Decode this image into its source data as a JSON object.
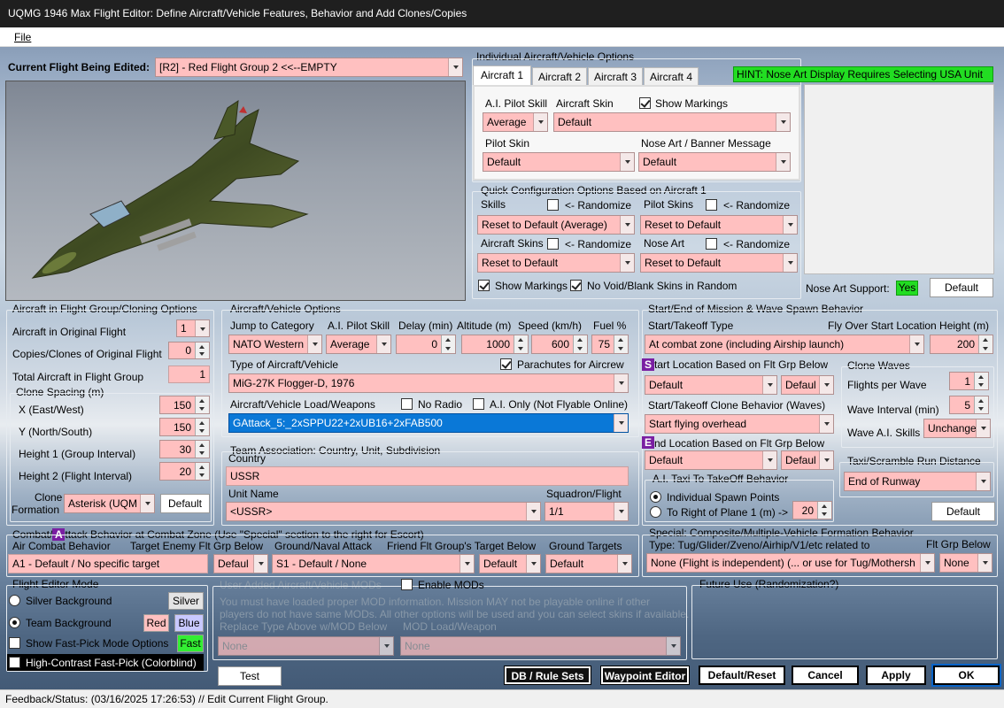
{
  "window": {
    "title": "UQMG 1946 Max Flight Editor:  Define Aircraft/Vehicle Features, Behavior and Add Clones/Copies"
  },
  "menu": {
    "file": "File"
  },
  "flight": {
    "label": "Current Flight Being Edited:",
    "value": "[R2] -  Red Flight Group  2     <<--EMPTY"
  },
  "individual": {
    "title": "Individual Aircraft/Vehicle Options",
    "tabs": [
      "Aircraft 1",
      "Aircraft 2",
      "Aircraft 3",
      "Aircraft 4"
    ],
    "hint": "HINT:  Nose Art Display Requires Selecting USA Unit",
    "ai_pilot_skill_label": "A.I. Pilot Skill",
    "ai_pilot_skill": "Average",
    "aircraft_skin_label": "Aircraft Skin",
    "aircraft_skin": "Default",
    "show_markings": "Show Markings",
    "pilot_skin_label": "Pilot Skin",
    "pilot_skin": "Default",
    "nose_art_label": "Nose Art / Banner Message",
    "nose_art": "Default"
  },
  "quick": {
    "title": "Quick Configuration Options Based on Aircraft 1",
    "skills_label": "Skills",
    "randomize": "<- Randomize",
    "skills": "Reset to Default (Average)",
    "pilot_skins_label": "Pilot Skins",
    "pilot_skins": "Reset to Default",
    "aircraft_skins_label": "Aircraft Skins",
    "aircraft_skins": "Reset to Default",
    "nose_art_label": "Nose Art",
    "nose_art": "Reset to Default",
    "show_markings": "Show Markings",
    "no_void": "No Void/Blank Skins in Random"
  },
  "nose_support": {
    "label": "Nose Art Support:",
    "value": "Yes",
    "default_btn": "Default"
  },
  "cloning": {
    "title": "Aircraft in Flight Group/Cloning Options",
    "in_original_label": "Aircraft in Original Flight",
    "in_original": "1",
    "copies_label": "Copies/Clones of Original Flight",
    "copies": "0",
    "total_label": "Total Aircraft in Flight Group",
    "total": "1",
    "spacing_title": "Clone Spacing (m)",
    "x_label": "X (East/West)",
    "x": "150",
    "y_label": "Y (North/South)",
    "y": "150",
    "h1_label": "Height 1 (Group Interval)",
    "h1": "30",
    "h2_label": "Height 2 (Flight Interval)",
    "h2": "20",
    "formation_label1": "Clone",
    "formation_label2": "Formation",
    "formation": "Asterisk (UQM",
    "default_btn": "Default"
  },
  "vehicle": {
    "title": "Aircraft/Vehicle Options",
    "jump_label": "Jump to Category",
    "jump": "NATO Western",
    "skill_label": "A.I. Pilot Skill",
    "skill": "Average",
    "delay_label": "Delay (min)",
    "delay": "0",
    "alt_label": "Altitude (m)",
    "alt": "1000",
    "speed_label": "Speed (km/h)",
    "speed": "600",
    "fuel_label": "Fuel %",
    "fuel": "75",
    "type_label": "Type of Aircraft/Vehicle",
    "type": "MiG-27K Flogger-D, 1976",
    "parachutes": "Parachutes for Aircrew",
    "load_label": "Aircraft/Vehicle Load/Weapons",
    "load": "GAttack_5:_2xSPPU22+2xUB16+2xFAB500",
    "no_radio": "No Radio",
    "ai_only": "A.I. Only (Not Flyable Online)"
  },
  "team": {
    "title": "Team Association:  Country, Unit, Subdivision",
    "country_label": "Country",
    "country": "USSR",
    "unit_label": "Unit Name",
    "unit": "<USSR>",
    "squadron_label": "Squadron/Flight",
    "squadron": "1/1"
  },
  "spawn": {
    "title": "Start/End of Mission & Wave Spawn Behavior",
    "start_type_label": "Start/Takeoff Type",
    "start_type": "At combat zone (including Airship launch)",
    "fly_over_label": "Fly Over Start Location Height (m)",
    "fly_over": "200",
    "s_mark": "S",
    "start_loc_label": "tart Location Based on Flt Grp Below",
    "start_loc": "Default",
    "start_loc2": "Defaul",
    "clone_behavior_label": "Start/Takeoff Clone Behavior (Waves)",
    "clone_behavior": "Start flying overhead",
    "e_mark": "E",
    "end_loc_label": "nd Location Based on Flt Grp Below",
    "end_loc": "Default",
    "end_loc2": "Defaul",
    "taxi_title": "A.I. Taxi To TakeOff Behavior",
    "individual": "Individual Spawn Points",
    "right_of": "To Right of Plane 1 (m) ->",
    "right_of_val": "20",
    "waves_title": "Clone Waves",
    "flights_label": "Flights per Wave",
    "flights": "1",
    "interval_label": "Wave Interval (min)",
    "interval": "5",
    "ai_skills_label": "Wave A.I. Skills",
    "ai_skills": "Unchange",
    "taxi_run_title": "Taxi/Scramble Run Distance",
    "taxi_run": "End of Runway",
    "default_btn": "Default"
  },
  "combat": {
    "title_a": "Combat/",
    "mark": "A",
    "title_b": "ttack Behavior at Combat Zone (Use \"Special\" section to the right for Escort)",
    "air_label": "Air Combat Behavior",
    "air": "A1 - Default / No specific target",
    "enemy_label": "Target Enemy Flt Grp Below",
    "enemy": "Defaul",
    "ground_label": "Ground/Naval Attack",
    "ground": "S1 - Default / None",
    "friend_label": "Friend Flt Group's Target Below",
    "friend": "Default",
    "targets_label": "Ground Targets",
    "targets": "Default"
  },
  "special": {
    "title": "Special: Composite/Multiple-Vehicle Formation Behavior",
    "type_label": "Type: Tug/Glider/Zveno/Airhip/V1/etc related to",
    "type": "None (Flight is independent) (... or use for Tug/Mothersh",
    "flt_label": "Flt Grp Below",
    "flt": "None"
  },
  "mode": {
    "title": "Flight Editor Mode",
    "silver_bg": "Silver Background",
    "silver_btn": "Silver",
    "team_bg": "Team Background",
    "red_btn": "Red",
    "blue_btn": "Blue",
    "fast_pick": "Show Fast-Pick Mode Options",
    "fast_btn": "Fast",
    "high_contrast": "High-Contrast Fast-Pick (Colorblind)"
  },
  "mods": {
    "title": "User Added Aircraft/Vehicle MODs",
    "enable": "Enable MODs",
    "desc1": "You must have loaded proper MOD information.  Mission MAY not be playable online if other",
    "desc2": "players do not have same MODs.  All other options will be used and you can select skins if available.",
    "replace_label": "Replace Type Above w/MOD Below",
    "load_label": "MOD Load/Weapon",
    "replace": "None",
    "load": "None"
  },
  "future": {
    "title": "Future Use (Randomization?)"
  },
  "buttons": {
    "test": "Test",
    "db": "DB / Rule Sets",
    "waypoint": "Waypoint Editor",
    "default_reset": "Default/Reset",
    "cancel": "Cancel",
    "apply": "Apply",
    "ok": "OK"
  },
  "status": {
    "text": "Feedback/Status:  (03/16/2025 17:26:53) // Edit Current Flight Group."
  }
}
